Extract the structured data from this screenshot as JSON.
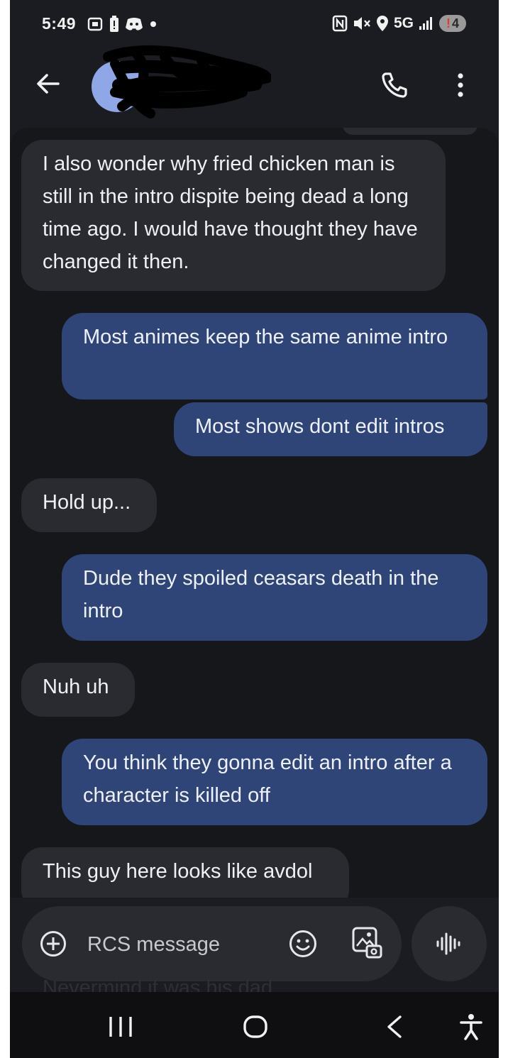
{
  "status_bar": {
    "time": "5:49",
    "network": "5G",
    "battery": "4",
    "battery_alert": "!"
  },
  "header": {
    "contact_name": "",
    "icons": [
      "back-arrow-icon",
      "avatar",
      "phone-icon",
      "more-vert-icon"
    ]
  },
  "messages": [
    {
      "direction": "incoming",
      "text": "I also wonder why fried chicken man is still in the intro dispite being dead a long time ago. I would have thought they have changed it then."
    },
    {
      "direction": "outgoing",
      "text": "Most animes keep the same anime intro"
    },
    {
      "direction": "outgoing",
      "text": "Most shows dont edit intros"
    },
    {
      "direction": "incoming",
      "text": "Hold up..."
    },
    {
      "direction": "outgoing",
      "text": "Dude they spoiled ceasars death in the intro"
    },
    {
      "direction": "incoming",
      "text": "Nuh uh"
    },
    {
      "direction": "outgoing",
      "text": "You think they gonna edit an intro after a character is killed off"
    },
    {
      "direction": "incoming",
      "text": "This guy here looks like avdol"
    },
    {
      "direction": "incoming",
      "text": "Nevermind it was his dad"
    }
  ],
  "composer": {
    "placeholder": "RCS message",
    "icons": [
      "add-circle-icon",
      "emoji-icon",
      "gallery-icon",
      "voice-waveform-icon"
    ]
  },
  "colors": {
    "background": "#1b1c21",
    "incoming_bubble": "#2a2b30",
    "outgoing_bubble": "#2f4577",
    "avatar": "#8fa7e6"
  }
}
